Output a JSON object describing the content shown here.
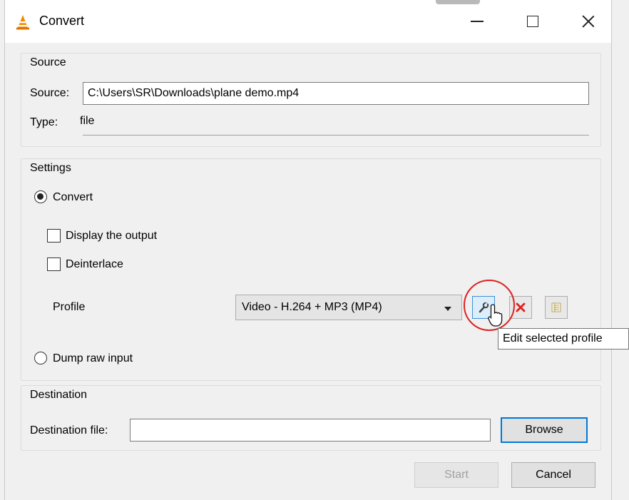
{
  "window": {
    "title": "Convert"
  },
  "source": {
    "group_title": "Source",
    "source_label": "Source:",
    "source_value": "C:\\Users\\SR\\Downloads\\plane demo.mp4",
    "type_label": "Type:",
    "type_value": "file"
  },
  "settings": {
    "group_title": "Settings",
    "convert_label": "Convert",
    "display_output_label": "Display the output",
    "deinterlace_label": "Deinterlace",
    "profile_label": "Profile",
    "profile_value": "Video - H.264 + MP3 (MP4)",
    "dump_raw_label": "Dump raw input",
    "tooltip": "Edit selected profile"
  },
  "destination": {
    "group_title": "Destination",
    "file_label": "Destination file:",
    "file_value": "",
    "browse_label": "Browse"
  },
  "footer": {
    "start_label": "Start",
    "cancel_label": "Cancel"
  },
  "colors": {
    "accent": "#0078d7",
    "highlight": "#dd2222",
    "delete": "#e02020"
  },
  "icons": [
    "vlc-cone-icon",
    "minimize-icon",
    "maximize-icon",
    "close-icon",
    "wrench-icon",
    "delete-icon",
    "new-profile-icon",
    "mouse-cursor-icon"
  ]
}
